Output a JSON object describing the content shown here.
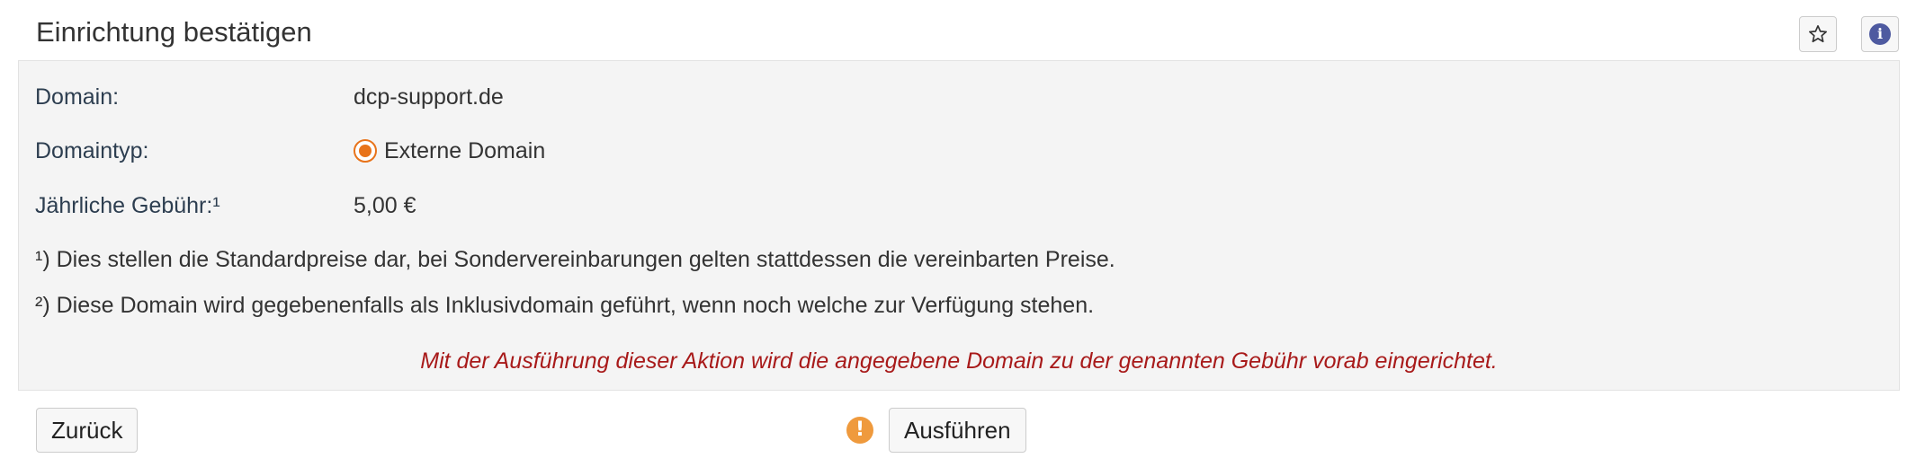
{
  "header": {
    "title": "Einrichtung bestätigen",
    "star_icon": "star-icon",
    "info_icon": "info-icon",
    "info_glyph": "i"
  },
  "details": {
    "domain_label": "Domain:",
    "domain_value": "dcp-support.de",
    "domaintype_label": "Domaintyp:",
    "domaintype_value": "Externe Domain",
    "fee_label": "Jährliche Gebühr:¹",
    "fee_value": "5,00 €"
  },
  "notes": {
    "note1": "¹) Dies stellen die Standardpreise dar, bei Sondervereinbarungen gelten stattdessen die vereinbarten Preise.",
    "note2": "²) Diese Domain wird gegebenenfalls als Inklusivdomain geführt, wenn noch welche zur Verfügung stehen.",
    "warning": "Mit der Ausführung dieser Aktion wird die angegebene Domain zu der genannten Gebühr vorab eingerichtet."
  },
  "footer": {
    "back_label": "Zurück",
    "run_label": "Ausführen",
    "alert_glyph": "!"
  },
  "colors": {
    "accent_orange": "#e8731a",
    "warning_red": "#a81a1a",
    "info_blue": "#4e5aa0",
    "panel_bg": "#f4f4f4"
  }
}
